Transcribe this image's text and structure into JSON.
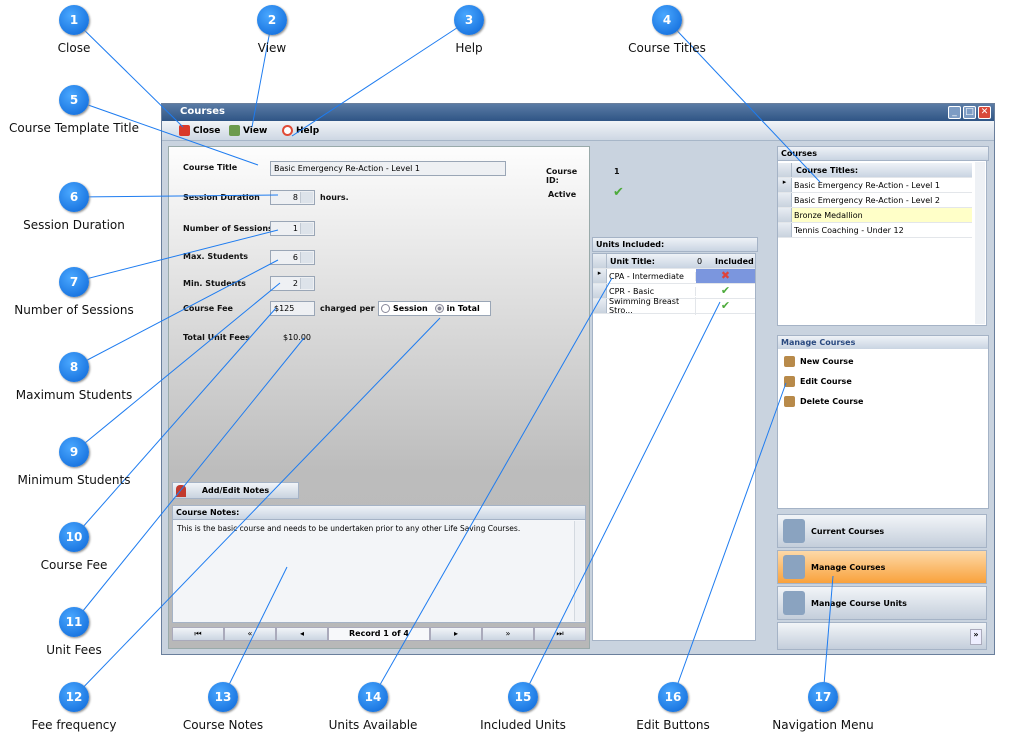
{
  "window": {
    "title": "Courses",
    "minimize": "_",
    "maximize": "□",
    "close": "✕"
  },
  "toolbar": {
    "close_label": "Close",
    "view_label": "View",
    "help_label": "Help"
  },
  "form": {
    "course_title_label": "Course Title",
    "course_title_value": "Basic Emergency Re-Action - Level 1",
    "session_duration_label": "Session Duration",
    "session_duration_value": "8",
    "hours_label": "hours.",
    "num_sessions_label": "Number of Sessions",
    "num_sessions_value": "1",
    "max_students_label": "Max. Students",
    "max_students_value": "6",
    "min_students_label": "Min. Students",
    "min_students_value": "2",
    "course_fee_label": "Course Fee",
    "course_fee_value": "$125",
    "charged_per_label": "charged per",
    "fee_options": [
      {
        "label": "Session",
        "selected": false
      },
      {
        "label": "in Total",
        "selected": true
      }
    ],
    "total_unit_fees_label": "Total Unit Fees",
    "total_unit_fees_value": "$10.00",
    "course_id_label": "Course ID:",
    "course_id_value": "1",
    "active_label": "Active",
    "active": true,
    "add_edit_notes_label": "Add/Edit Notes",
    "notes_header": "Course Notes:",
    "notes_text": "This is the basic course and needs to be undertaken prior to any other Life Saving Courses.",
    "record_label": "Record 1 of 4"
  },
  "units": {
    "header": "Units Included:",
    "col_title": "Unit Title:",
    "col_count": "0",
    "col_included": "Included",
    "rows": [
      {
        "title": "CPA - Intermediate",
        "included": false
      },
      {
        "title": "CPR - Basic",
        "included": true
      },
      {
        "title": "Swimming Breast Stro...",
        "included": true
      }
    ]
  },
  "courses": {
    "header": "Courses",
    "col_title": "Course Titles:",
    "rows": [
      "Basic Emergency Re-Action - Level 1",
      "Basic Emergency Re-Action - Level 2",
      "Bronze Medallion",
      "Tennis Coaching - Under 12"
    ]
  },
  "manage": {
    "header": "Manage Courses",
    "items": [
      "New Course",
      "Edit Course",
      "Delete Course"
    ]
  },
  "nav": {
    "items": [
      "Current Courses",
      "Manage Courses",
      "Manage Course Units"
    ],
    "active": "Manage Courses"
  },
  "callouts": [
    {
      "n": "1",
      "label": "Close"
    },
    {
      "n": "2",
      "label": "View"
    },
    {
      "n": "3",
      "label": "Help"
    },
    {
      "n": "4",
      "label": "Course Titles"
    },
    {
      "n": "5",
      "label": "Course Template Title"
    },
    {
      "n": "6",
      "label": "Session Duration"
    },
    {
      "n": "7",
      "label": "Number of Sessions"
    },
    {
      "n": "8",
      "label": "Maximum Students"
    },
    {
      "n": "9",
      "label": "Minimum Students"
    },
    {
      "n": "10",
      "label": "Course Fee"
    },
    {
      "n": "11",
      "label": "Unit Fees"
    },
    {
      "n": "12",
      "label": "Fee frequency"
    },
    {
      "n": "13",
      "label": "Course Notes"
    },
    {
      "n": "14",
      "label": "Units Available"
    },
    {
      "n": "15",
      "label": "Included Units"
    },
    {
      "n": "16",
      "label": "Edit Buttons"
    },
    {
      "n": "17",
      "label": "Navigation Menu"
    }
  ],
  "colors": {
    "callout": "#0a64d6",
    "nav_active": "#f9a23c",
    "highlight_row": "#ffffc8",
    "included_selected": "#7b96de"
  }
}
